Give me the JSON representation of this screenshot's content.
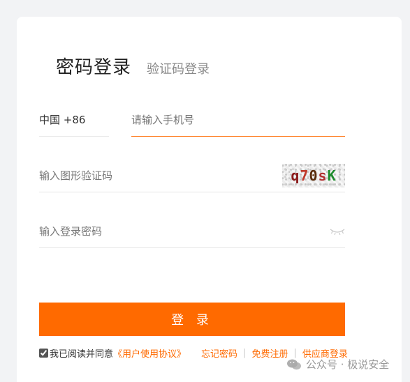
{
  "tabs": {
    "active": "密码登录",
    "inactive": "验证码登录"
  },
  "phone": {
    "country_code": "中国 +86",
    "placeholder": "请输入手机号"
  },
  "captcha": {
    "placeholder": "输入图形验证码",
    "chars": [
      "q",
      "7",
      "0",
      "s",
      "K"
    ]
  },
  "password": {
    "placeholder": "输入登录密码"
  },
  "login_button": "登 录",
  "agreement": {
    "checked": true,
    "text": "我已阅读并同意",
    "terms_link": "《用户使用协议》",
    "forgot_password": "忘记密码",
    "register": "免费注册",
    "supplier_login": "供应商登录"
  },
  "watermark": {
    "text": "公众号 · 极说安全"
  },
  "colors": {
    "accent": "#ff6a00",
    "background": "#f2f3f5"
  }
}
